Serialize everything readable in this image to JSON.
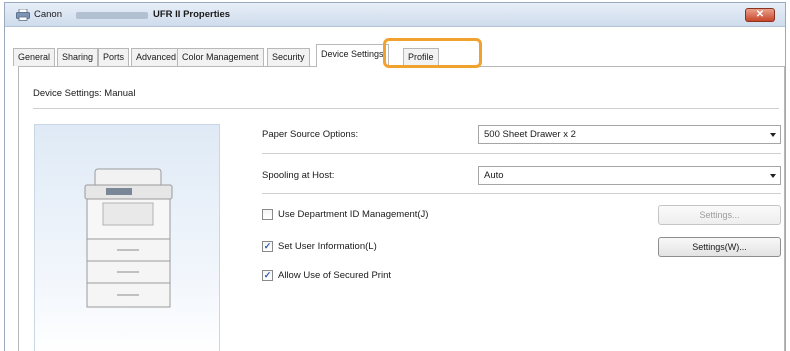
{
  "window": {
    "title_prefix": "Canon",
    "title_suffix": "UFR II Properties",
    "close_label": "✕"
  },
  "tabs": [
    {
      "label": "General"
    },
    {
      "label": "Sharing"
    },
    {
      "label": "Ports"
    },
    {
      "label": "Advanced"
    },
    {
      "label": "Color Management"
    },
    {
      "label": "Security"
    },
    {
      "label": "Device Settings",
      "active": true
    },
    {
      "label": "Profile"
    }
  ],
  "panel": {
    "section_label": "Device Settings: Manual",
    "paper_source": {
      "label": "Paper Source Options:",
      "value": "500 Sheet Drawer x 2"
    },
    "spooling": {
      "label": "Spooling at Host:",
      "value": "Auto"
    },
    "department_id": {
      "label": "Use Department ID Management(J)",
      "checked": false,
      "button_label": "Settings..."
    },
    "user_info": {
      "label": "Set User Information(L)",
      "checked": true,
      "button_label": "Settings(W)..."
    },
    "secured_print": {
      "label": "Allow Use of Secured Print",
      "checked": true
    }
  },
  "colors": {
    "highlight": "#f1a22e",
    "close_button": "#c8462b",
    "titlebar": "#cfdcec"
  },
  "icons": {
    "app": "printer-icon",
    "close": "close-icon",
    "dropdown": "chevron-down-icon",
    "check": "checkmark-icon"
  }
}
